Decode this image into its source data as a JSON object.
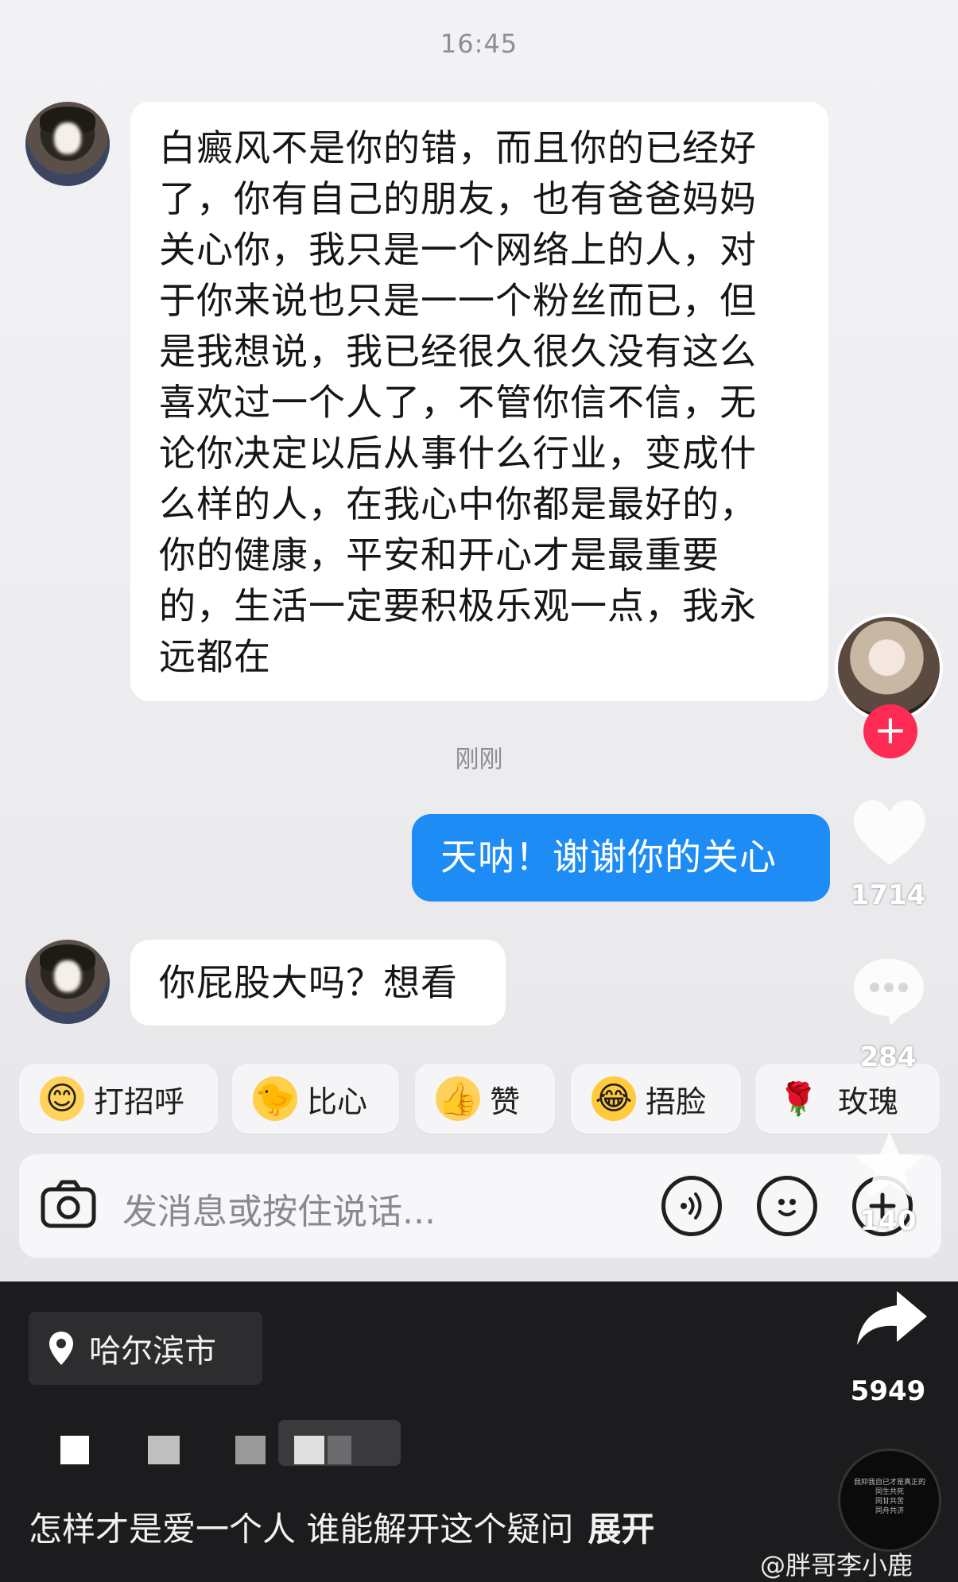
{
  "chat": {
    "time": "16:45",
    "sub_time": "刚刚",
    "messages": [
      {
        "lines": [
          "白癜风不是你的错，而且你的已经好",
          "了，你有自己的朋友，也有爸爸妈妈",
          "关心你，我只是一个网络上的人，对",
          "于你来说也只是一一个粉丝而已，但",
          "是我想说，我已经很久很久没有这么",
          "喜欢过一个人了，不管你信不信，无",
          "论你决定以后从事什么行业，变成什",
          "么样的人，在我心中你都是最好的，",
          "你的健康，平安和开心才是最重要",
          "的，生活一定要积极乐观一点，我永",
          "远都在"
        ]
      },
      {
        "text": "天呐！谢谢你的关心"
      },
      {
        "text": "你屁股大吗？想看"
      }
    ]
  },
  "quick_replies": [
    {
      "label": "打招呼",
      "emoji": "😊"
    },
    {
      "label": "比心",
      "emoji": "🐤"
    },
    {
      "label": "赞",
      "emoji": "👍"
    },
    {
      "label": "捂脸",
      "emoji": "😂"
    },
    {
      "label": "玫瑰",
      "emoji": "🌹"
    }
  ],
  "input": {
    "placeholder": "发消息或按住说话..."
  },
  "side": {
    "likes": "1714",
    "comments": "284",
    "favorites": "140",
    "shares": "5949"
  },
  "bottom": {
    "location": "哈尔滨市",
    "caption": "怎样才是爱一个人 谁能解开这个疑问",
    "expand": "展开",
    "disc_text": [
      "我抑我自已才是真正的",
      "同生共死",
      "同甘共苦",
      "同舟共济"
    ],
    "watermark": "@胖哥李小鹿"
  },
  "colors": {
    "sent_bubble": "#1d8cf5",
    "follow_plus": "#fe2c55",
    "bottom_bg": "#1c1c1e"
  }
}
